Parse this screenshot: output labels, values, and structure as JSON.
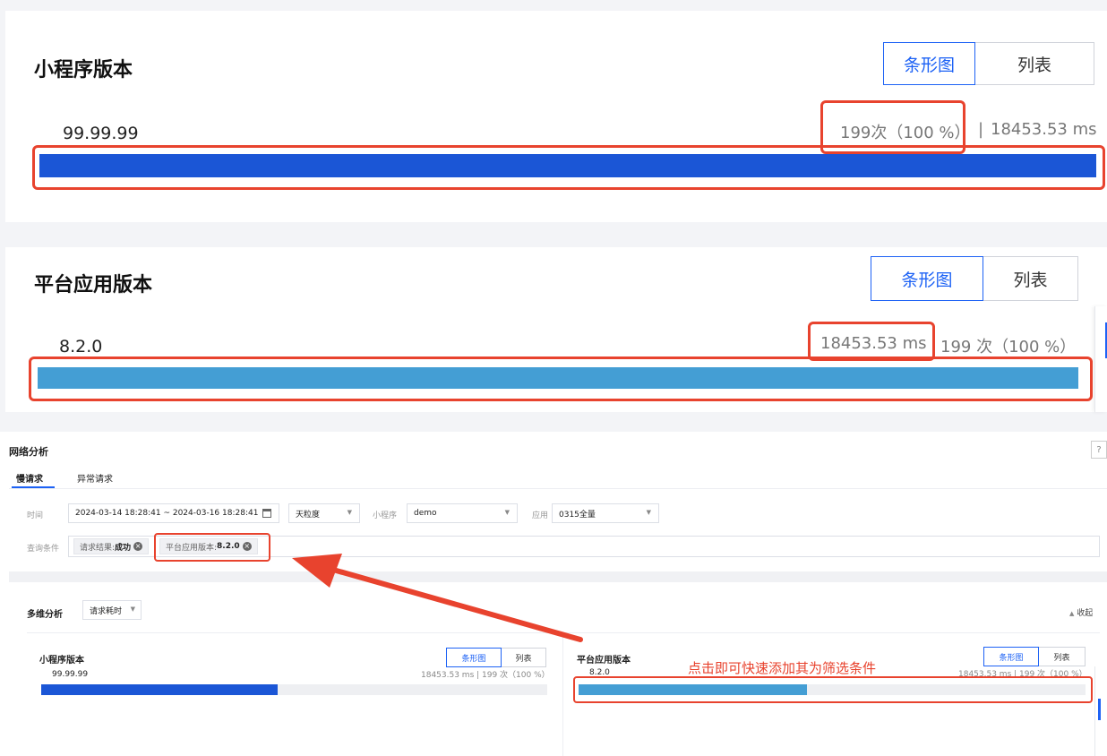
{
  "top_panel_1": {
    "title": "小程序版本",
    "tabs": [
      "条形图",
      "列表"
    ],
    "row_label": "99.99.99",
    "count": "199次（100 %）",
    "separator": "|",
    "duration": "18453.53 ms",
    "bar_fraction": 1.0,
    "bar_color": "#1b56d6"
  },
  "top_panel_2": {
    "title": "平台应用版本",
    "tabs": [
      "条形图",
      "列表"
    ],
    "row_label": "8.2.0",
    "duration": "18453.53 ms",
    "count": "199 次（100 %）",
    "bar_fraction": 1.0,
    "bar_color": "#449ed4"
  },
  "network": {
    "title": "网络分析",
    "help": "?",
    "tabs": [
      "慢请求",
      "异常请求"
    ],
    "time_label": "时间",
    "time_range": "2024-03-14 18:28:41  ~ 2024-03-16 18:28:41",
    "granularity": "天粒度",
    "miniprogram_label": "小程序",
    "miniprogram_value": "demo",
    "app_label": "应用",
    "app_value": "0315全量",
    "query_label": "查询条件",
    "chips": [
      {
        "key": "请求结果: ",
        "value": "成功"
      },
      {
        "key": "平台应用版本: ",
        "value": "8.2.0"
      }
    ]
  },
  "multi": {
    "title": "多维分析",
    "metric": "请求耗时",
    "collapse": "收起",
    "card_left": {
      "title": "小程序版本",
      "tabs": [
        "条形图",
        "列表"
      ],
      "row_label": "99.99.99",
      "meta": "18453.53 ms | 199 次（100 %）",
      "bar_fraction": 0.46,
      "bar_color": "#1b56d6"
    },
    "card_right": {
      "title": "平台应用版本",
      "tabs": [
        "条形图",
        "列表"
      ],
      "row_label": "8.2.0",
      "meta": "18453.53 ms | 199 次（100 %）",
      "bar_fraction": 0.45,
      "bar_color": "#449ed4"
    }
  },
  "annotation": {
    "text": "点击即可快速添加其为筛选条件",
    "color": "#e8432e"
  }
}
